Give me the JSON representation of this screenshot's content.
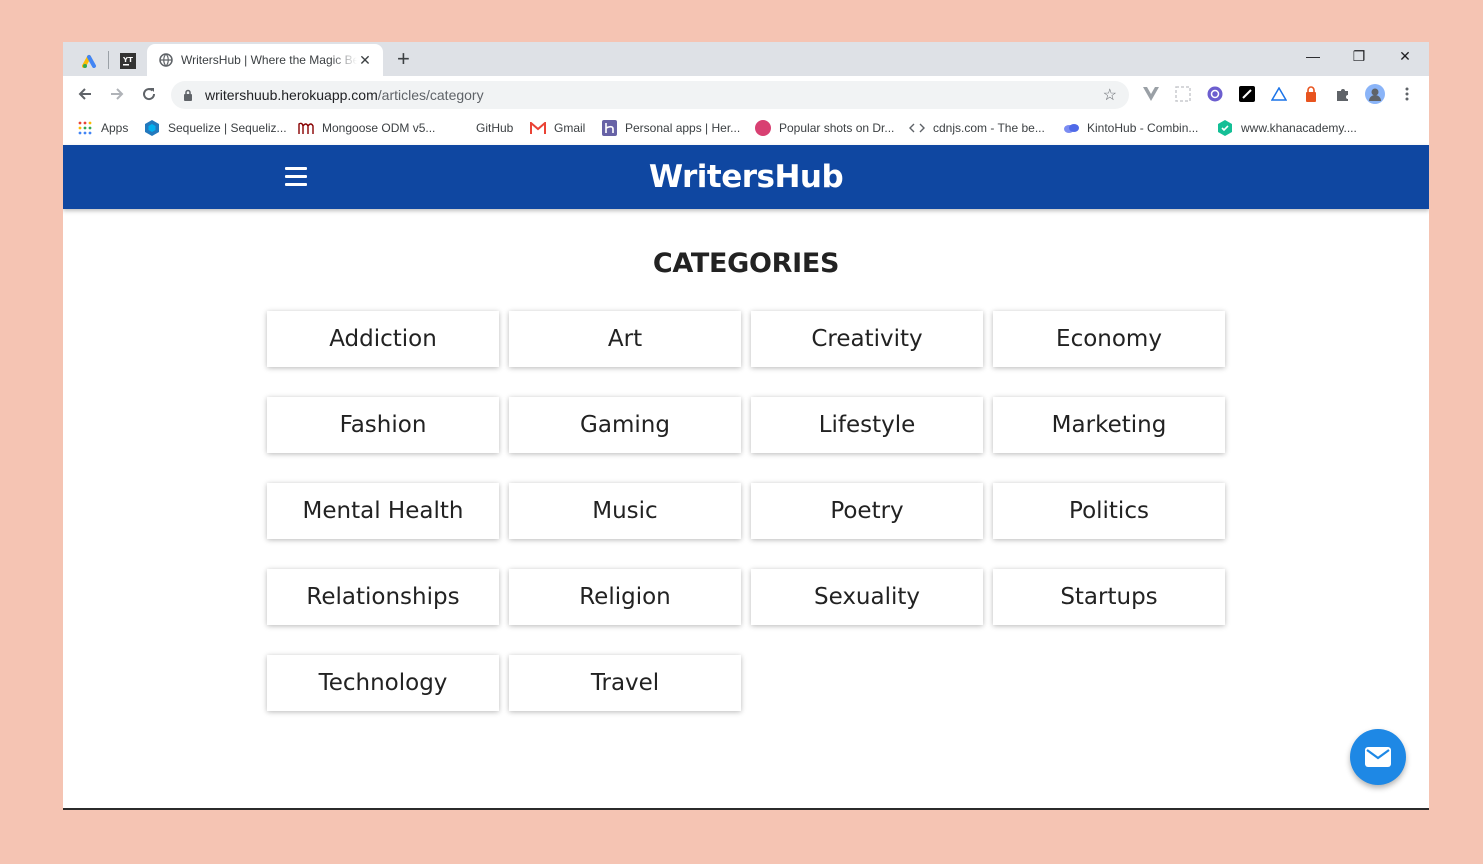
{
  "browser": {
    "active_tab_title": "WritersHub | Where the Magic Begins",
    "new_tab_symbol": "+",
    "close_tab_symbol": "✕",
    "url_host": "writershuub.herokuapp.com",
    "url_path": "/articles/category",
    "window_controls": {
      "minimize": "—",
      "maximize": "❐",
      "close": "✕"
    },
    "nav_icons": [
      "back-icon",
      "forward-icon",
      "reload-icon"
    ],
    "extension_icons": [
      "vue-devtools-icon",
      "extension-placeholder-icon",
      "shield-extension-icon",
      "notion-icon",
      "drive-icon",
      "lastpass-icon",
      "puzzle-icon",
      "profile-avatar-icon",
      "menu-dots-icon"
    ]
  },
  "bookmarks": [
    {
      "label": "Apps",
      "icon": "apps-grid-icon"
    },
    {
      "label": "Sequelize | Sequeliz...",
      "icon": "sequelize-icon"
    },
    {
      "label": "Mongoose ODM v5...",
      "icon": "mongoose-icon"
    },
    {
      "label": "GitHub",
      "icon": "github-icon"
    },
    {
      "label": "Gmail",
      "icon": "gmail-icon"
    },
    {
      "label": "Personal apps | Her...",
      "icon": "heroku-icon"
    },
    {
      "label": "Popular shots on Dr...",
      "icon": "dribbble-icon"
    },
    {
      "label": "cdnjs.com - The be...",
      "icon": "code-icon"
    },
    {
      "label": "KintoHub - Combin...",
      "icon": "kintohub-icon"
    },
    {
      "label": "www.khanacademy....",
      "icon": "khanacademy-icon"
    }
  ],
  "site": {
    "brand": "WritersHub",
    "page_title": "CATEGORIES",
    "brand_color": "#0f47a1",
    "fab_color": "#1e88e5"
  },
  "categories": [
    "Addiction",
    "Art",
    "Creativity",
    "Economy",
    "Fashion",
    "Gaming",
    "Lifestyle",
    "Marketing",
    "Mental Health",
    "Music",
    "Poetry",
    "Politics",
    "Relationships",
    "Religion",
    "Sexuality",
    "Startups",
    "Technology",
    "Travel"
  ]
}
